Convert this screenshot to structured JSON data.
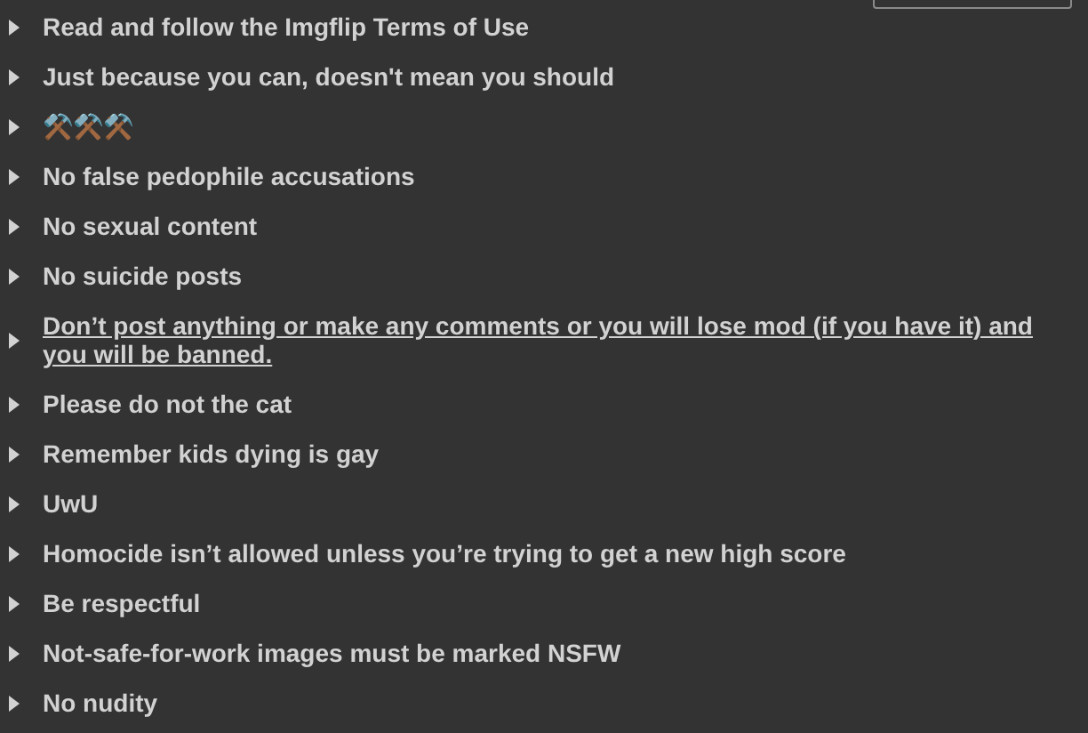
{
  "rules": [
    {
      "text": "Read and follow the Imgflip Terms of Use",
      "underlined": false,
      "expanded": false
    },
    {
      "text": "Just because you can, doesn't mean you should",
      "underlined": false,
      "expanded": false
    },
    {
      "text": "⚒️⚒️⚒️",
      "underlined": false,
      "expanded": false
    },
    {
      "text": "No false pedophile accusations",
      "underlined": false,
      "expanded": false
    },
    {
      "text": "No sexual content",
      "underlined": false,
      "expanded": false
    },
    {
      "text": "No suicide posts",
      "underlined": false,
      "expanded": false
    },
    {
      "text": "Don’t post anything or make any comments or you will lose mod (if you have it) and you will be banned.",
      "underlined": true,
      "expanded": false
    },
    {
      "text": "Please do not the cat",
      "underlined": false,
      "expanded": false
    },
    {
      "text": "Remember kids dying is gay",
      "underlined": false,
      "expanded": false
    },
    {
      "text": "UwU",
      "underlined": false,
      "expanded": false
    },
    {
      "text": "Homocide isn’t allowed unless you’re trying to get a new high score",
      "underlined": false,
      "expanded": false
    },
    {
      "text": "Be respectful",
      "underlined": false,
      "expanded": false
    },
    {
      "text": "Not-safe-for-work images must be marked NSFW",
      "underlined": false,
      "expanded": false
    },
    {
      "text": "No nudity",
      "underlined": false,
      "expanded": false
    }
  ]
}
